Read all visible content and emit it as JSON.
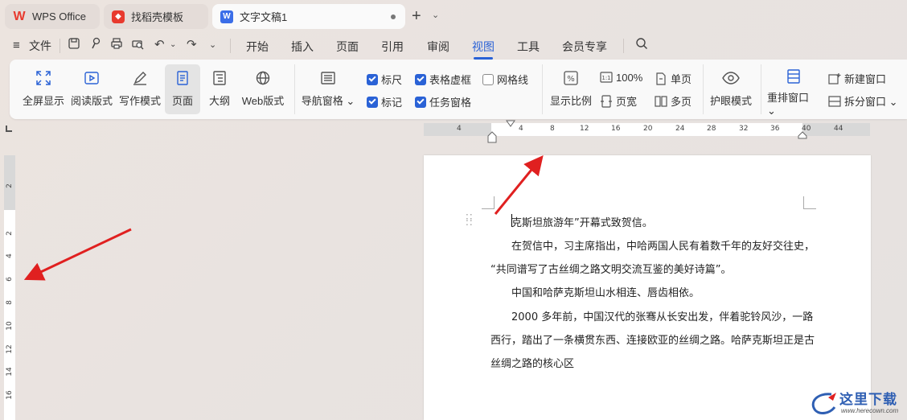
{
  "tabs": [
    {
      "label": "WPS Office",
      "icon": "wps-logo-icon"
    },
    {
      "label": "找稻壳模板",
      "icon": "docer-icon"
    },
    {
      "label": "文字文稿1",
      "icon": "writer-doc-icon"
    }
  ],
  "menubar": {
    "file_label": "文件",
    "tabs": [
      "开始",
      "插入",
      "页面",
      "引用",
      "审阅",
      "视图",
      "工具",
      "会员专享"
    ],
    "active_tab": "视图"
  },
  "ribbon": {
    "view_modes": [
      {
        "label": "全屏显示",
        "icon": "fullscreen-icon"
      },
      {
        "label": "阅读版式",
        "icon": "read-mode-icon"
      },
      {
        "label": "写作模式",
        "icon": "write-mode-icon"
      },
      {
        "label": "页面",
        "icon": "page-view-icon"
      },
      {
        "label": "大纲",
        "icon": "outline-icon"
      },
      {
        "label": "Web版式",
        "icon": "web-layout-icon"
      }
    ],
    "nav_pane": "导航窗格",
    "checks": [
      {
        "label": "标尺",
        "checked": true
      },
      {
        "label": "表格虚框",
        "checked": true
      },
      {
        "label": "网格线",
        "checked": false
      },
      {
        "label": "标记",
        "checked": true
      },
      {
        "label": "任务窗格",
        "checked": true
      }
    ],
    "zoom_label": "显示比例",
    "zoom_100": "100%",
    "page_width": "页宽",
    "single_page": "单页",
    "multi_page": "多页",
    "eye_mode": "护眼模式",
    "arrange_window": "重排窗口",
    "new_window": "新建窗口",
    "split_window": "拆分窗口"
  },
  "hruler": [
    "4",
    "4",
    "8",
    "12",
    "16",
    "20",
    "24",
    "28",
    "32",
    "36",
    "40",
    "44"
  ],
  "vruler": [
    "2",
    "2",
    "4",
    "6",
    "8",
    "10",
    "12",
    "14",
    "16"
  ],
  "document": {
    "lines": [
      "克斯坦旅游年”开幕式致贺信。",
      "在贺信中，习主席指出，中哈两国人民有着数千年的友好交往史，",
      "“共同谱写了古丝绸之路文明交流互鉴的美好诗篇”。",
      "中国和哈萨克斯坦山水相连、唇齿相依。",
      "2000 多年前，中国汉代的张骞从长安出发，伴着驼铃风沙，一路",
      "西行，踏出了一条横贯东西、连接欧亚的丝绸之路。哈萨克斯坦正是古",
      "丝绸之路的核心区"
    ]
  },
  "watermark": {
    "text": "这里下载",
    "url": "www.herecown.com"
  },
  "colors": {
    "accent": "#2a62d6",
    "arrow": "#e02020"
  }
}
